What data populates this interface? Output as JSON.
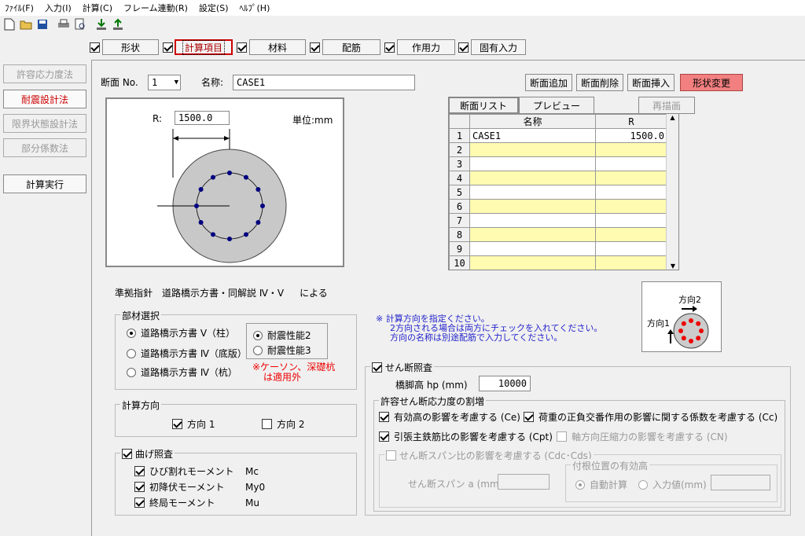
{
  "menu": [
    "ﾌｧｲﾙ(F)",
    "入力(I)",
    "計算(C)",
    "フレーム連動(R)",
    "設定(S)",
    "ﾍﾙﾌﾟ(H)"
  ],
  "toolbar_icons": [
    "new-file-icon",
    "open-folder-icon",
    "save-icon",
    "print-icon",
    "print-preview-icon",
    "import-icon",
    "export-icon"
  ],
  "tabs": [
    {
      "label": "形状",
      "checked": true
    },
    {
      "label": "計算項目",
      "checked": true
    },
    {
      "label": "材料",
      "checked": true
    },
    {
      "label": "配筋",
      "checked": true
    },
    {
      "label": "作用力",
      "checked": true
    },
    {
      "label": "固有入力",
      "checked": true
    }
  ],
  "side": {
    "items": [
      "許容応力度法",
      "耐震設計法",
      "限界状態設計法",
      "部分係数法"
    ],
    "run": "計算実行"
  },
  "section": {
    "no_label": "断面 No.",
    "no_value": "1",
    "name_label": "名称:",
    "name_value": "CASE1"
  },
  "buttons": {
    "add": "断面追加",
    "del": "断面削除",
    "insert": "断面挿入",
    "change": "形状変更",
    "list": "断面リスト",
    "preview": "プレビュー",
    "redraw": "再描画"
  },
  "drawing": {
    "r_label": "R:",
    "r_value": "1500.0",
    "unit": "単位:mm"
  },
  "grid": {
    "headers": [
      "名称",
      "R"
    ],
    "rows": [
      {
        "n": "1",
        "name": "CASE1",
        "r": "1500.0"
      },
      {
        "n": "2",
        "name": "",
        "r": ""
      },
      {
        "n": "3",
        "name": "",
        "r": ""
      },
      {
        "n": "4",
        "name": "",
        "r": ""
      },
      {
        "n": "5",
        "name": "",
        "r": ""
      },
      {
        "n": "6",
        "name": "",
        "r": ""
      },
      {
        "n": "7",
        "name": "",
        "r": ""
      },
      {
        "n": "8",
        "name": "",
        "r": ""
      },
      {
        "n": "9",
        "name": "",
        "r": ""
      },
      {
        "n": "10",
        "name": "",
        "r": ""
      }
    ]
  },
  "standard": {
    "label": "準拠指針",
    "text": "道路橋示方書・同解説 Ⅳ・Ⅴ",
    "suffix": "による"
  },
  "member": {
    "title": "部材選択",
    "options": [
      "道路橋示方書 Ⅴ（柱）",
      "道路橋示方書 Ⅳ（底版）",
      "道路橋示方書 Ⅳ（杭）"
    ],
    "perf": [
      "耐震性能2",
      "耐震性能3"
    ],
    "note1": "※ケーソン、深礎杭",
    "note2": "は適用外"
  },
  "direction": {
    "title": "計算方向",
    "d1": "方向 1",
    "d2": "方向 2"
  },
  "bending": {
    "title": "曲げ照査",
    "items": [
      {
        "label": "ひび割れモーメント",
        "sym": "Mc"
      },
      {
        "label": "初降伏モーメント",
        "sym": "My0"
      },
      {
        "label": "終局モーメント",
        "sym": "Mu"
      }
    ]
  },
  "notice": {
    "l1": "※ 計算方向を指定ください。",
    "l2": "2方向される場合は両方にチェックを入れてください。",
    "l3": "方向の名称は別途配筋で入力してください。"
  },
  "diagram": {
    "dir1": "方向1",
    "dir2": "方向2"
  },
  "shear": {
    "title": "せん断照査",
    "height_label": "橋脚高 hp (mm)",
    "height_value": "10000",
    "allow_title": "許容せん断応力度の割増",
    "ce": "有効高の影響を考慮する (Ce)",
    "cc": "荷重の正負交番作用の影響に関する係数を考慮する (Cc)",
    "cpt": "引張主鉄筋比の影響を考慮する (Cpt)",
    "cn": "軸方向圧縮力の影響を考慮する (CN)",
    "cdc": "せん断スパン比の影響を考慮する (Cdc･Cds)",
    "span_label": "せん断スパン a (mm)",
    "root_title": "付根位置の有効高",
    "auto": "自動計算",
    "input": "入力値(mm)"
  }
}
